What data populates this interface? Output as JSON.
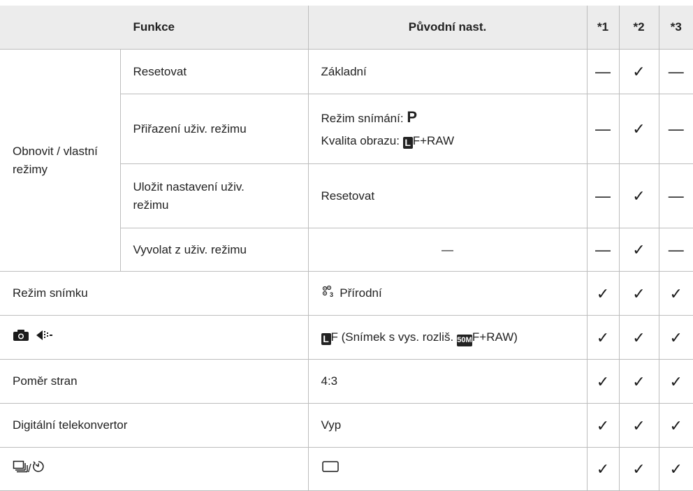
{
  "header": {
    "col_function": "Funkce",
    "col_default": "Původní nast.",
    "col1": "*1",
    "col2": "*2",
    "col3": "*3"
  },
  "marks": {
    "check": "✓",
    "dash": "—"
  },
  "group": {
    "label": "Obnovit / vlastní režimy"
  },
  "rows": [
    {
      "label": "Resetovat",
      "value": "Základní",
      "c1": "—",
      "c2": "✓",
      "c3": "—"
    },
    {
      "label": "Přiřazení uživ. režimu",
      "value_line1_prefix": "Režim snímání: ",
      "value_line1_mode": "P",
      "value_line2_prefix": "Kvalita obrazu: ",
      "value_line2_badge": "L",
      "value_line2_suffix": "F+RAW",
      "c1": "—",
      "c2": "✓",
      "c3": "—"
    },
    {
      "label": "Uložit nastavení uživ. režimu",
      "value": "Resetovat",
      "c1": "—",
      "c2": "✓",
      "c3": "—"
    },
    {
      "label": "Vyvolat z uživ. režimu",
      "value": "—",
      "c1": "—",
      "c2": "✓",
      "c3": "—"
    },
    {
      "label": "Režim snímku",
      "value_icon": "picture-mode-natural-icon",
      "value": "Přírodní",
      "c1": "✓",
      "c2": "✓",
      "c3": "✓"
    },
    {
      "label_icons": [
        "camera-icon",
        "image-stabilizer-icon"
      ],
      "value_badge": "L",
      "value_part1": "F (Snímek s vys. rozliš. ",
      "value_badge2": "50M",
      "value_part2": "F+RAW)",
      "c1": "✓",
      "c2": "✓",
      "c3": "✓"
    },
    {
      "label": "Poměr stran",
      "value": "4:3",
      "c1": "✓",
      "c2": "✓",
      "c3": "✓"
    },
    {
      "label": "Digitální telekonvertor",
      "value": "Vyp",
      "c1": "✓",
      "c2": "✓",
      "c3": "✓"
    },
    {
      "label_icons": [
        "sequential-shooting-icon",
        "self-timer-icon"
      ],
      "label_sep": "/",
      "value_icon": "single-frame-icon",
      "c1": "✓",
      "c2": "✓",
      "c3": "✓"
    }
  ]
}
